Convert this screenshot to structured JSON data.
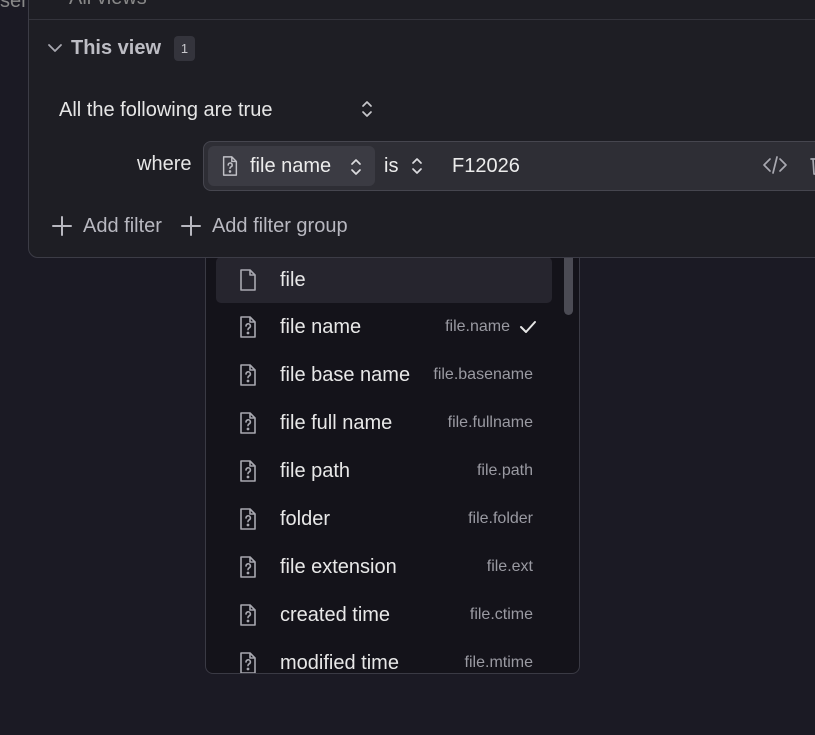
{
  "background": {
    "left_text": "ser"
  },
  "panel": {
    "top_label": "All views",
    "section_title": "This view",
    "section_count": "1",
    "conjunction": "All the following are true",
    "where_label": "where",
    "filter": {
      "property": "file name",
      "operator": "is",
      "value": "F12026"
    },
    "add_filter": "Add filter",
    "add_filter_group": "Add filter group"
  },
  "dropdown": {
    "items": [
      {
        "label": "file",
        "key": "",
        "icon": "file-icon",
        "highlighted": true,
        "checked": false
      },
      {
        "label": "file name",
        "key": "file.name",
        "icon": "file-question-icon",
        "highlighted": false,
        "checked": true
      },
      {
        "label": "file base name",
        "key": "file.basename",
        "icon": "file-question-icon",
        "highlighted": false,
        "checked": false
      },
      {
        "label": "file full name",
        "key": "file.fullname",
        "icon": "file-question-icon",
        "highlighted": false,
        "checked": false
      },
      {
        "label": "file path",
        "key": "file.path",
        "icon": "file-question-icon",
        "highlighted": false,
        "checked": false
      },
      {
        "label": "folder",
        "key": "file.folder",
        "icon": "file-question-icon",
        "highlighted": false,
        "checked": false
      },
      {
        "label": "file extension",
        "key": "file.ext",
        "icon": "file-question-icon",
        "highlighted": false,
        "checked": false
      },
      {
        "label": "created time",
        "key": "file.ctime",
        "icon": "file-question-icon",
        "highlighted": false,
        "checked": false
      },
      {
        "label": "modified time",
        "key": "file.mtime",
        "icon": "file-question-icon",
        "highlighted": false,
        "checked": false
      }
    ]
  },
  "colors": {
    "background": "#1b1a24",
    "panel": "#1e1e24",
    "filter_row": "#2e2e35",
    "property_segment": "#3b3b43",
    "dropdown": "#14131a",
    "highlight": "#26252e"
  }
}
